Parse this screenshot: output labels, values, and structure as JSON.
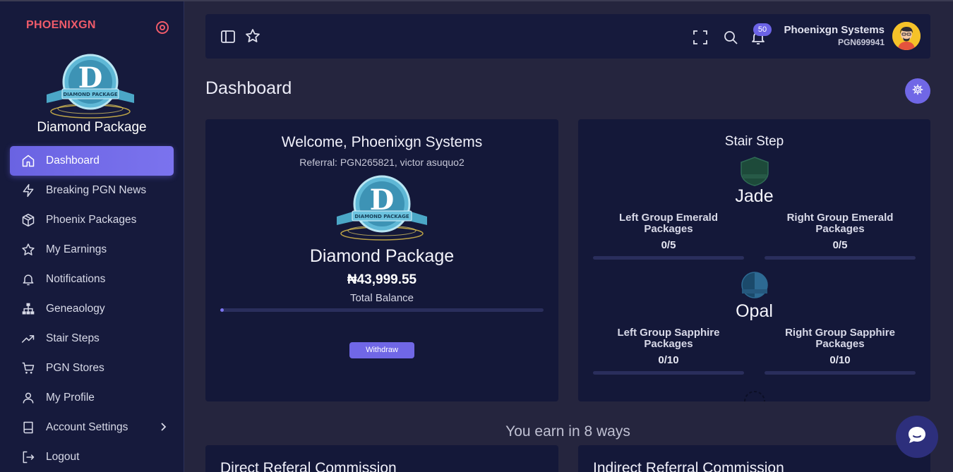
{
  "sidebar": {
    "brand": "PHOENIXGN",
    "package_name": "Diamond Package",
    "items": [
      {
        "label": "Dashboard",
        "icon": "home-icon",
        "active": true
      },
      {
        "label": "Breaking PGN News",
        "icon": "lightning-icon"
      },
      {
        "label": "Phoenix Packages",
        "icon": "box-icon"
      },
      {
        "label": "My Earnings",
        "icon": "star-icon"
      },
      {
        "label": "Notifications",
        "icon": "bell-icon"
      },
      {
        "label": "Geneaology",
        "icon": "hierarchy-icon"
      },
      {
        "label": "Stair Steps",
        "icon": "trending-up-icon"
      },
      {
        "label": "PGN Stores",
        "icon": "cart-icon"
      },
      {
        "label": "My Profile",
        "icon": "user-icon"
      },
      {
        "label": "Account Settings",
        "icon": "book-icon",
        "has_submenu": true
      },
      {
        "label": "Logout",
        "icon": "logout-icon"
      }
    ]
  },
  "header": {
    "notification_count": "50",
    "user_name": "Phoenixgn Systems",
    "user_id": "PGN699941"
  },
  "page": {
    "title": "Dashboard"
  },
  "welcome": {
    "title": "Welcome, Phoenixgn Systems",
    "referral": "Referral: PGN265821, victor asuquo2",
    "package": "Diamond Package",
    "amount": "₦43,999.55",
    "balance_label": "Total Balance",
    "balance_progress": 0.01,
    "withdraw_label": "Withdraw"
  },
  "stair": {
    "title": "Stair Step",
    "ranks": [
      {
        "name": "Jade",
        "left_label": "Left Group Emerald Packages",
        "left_value": "0/5",
        "right_label": "Right Group Emerald Packages",
        "right_value": "0/5"
      },
      {
        "name": "Opal",
        "left_label": "Left Group Sapphire Packages",
        "left_value": "0/10",
        "right_label": "Right Group Sapphire Packages",
        "right_value": "0/10"
      }
    ]
  },
  "earn": {
    "title": "You earn in 8 ways",
    "cards": [
      {
        "title": "Direct Referal Commission"
      },
      {
        "title": "Indirect Referral Commission"
      }
    ]
  },
  "colors": {
    "accent": "#7067e6",
    "brand": "#ef5b6a",
    "sidebar_bg": "#161a3c",
    "page_bg": "#25253e",
    "card_bg": "#141839"
  }
}
